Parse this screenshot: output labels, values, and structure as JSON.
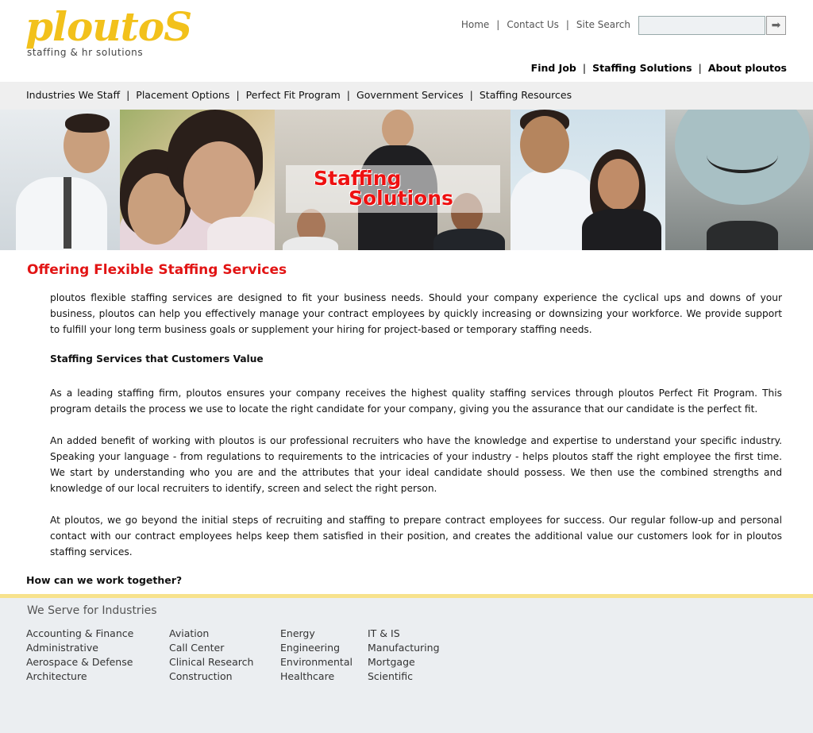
{
  "logo": {
    "word": "ploutoS",
    "tagline": "staffing & hr solutions",
    "color": "#f2c11b"
  },
  "toplinks": {
    "home": "Home",
    "contact": "Contact Us",
    "search_label": "Site Search",
    "separator": "|"
  },
  "search": {
    "value": "",
    "button_icon": "arrow-right-icon"
  },
  "mainnav": {
    "find_job": "Find Job",
    "staffing": "Staffing Solutions",
    "about": "About ploutos",
    "separator": "|"
  },
  "subnav": {
    "items": [
      "Industries We Staff",
      "Placement Options",
      "Perfect Fit Program",
      "Government Services",
      "Staffing Resources"
    ],
    "separator": "|"
  },
  "banner": {
    "line1": "Staffing",
    "line2": "Solutions",
    "title_color": "#e11111"
  },
  "content": {
    "title": "Offering Flexible Staffing Services",
    "p1": "ploutos flexible staffing services are designed to fit your business needs. Should your company experience the cyclical ups and downs of your business, ploutos can help you effectively manage your contract employees by quickly increasing or downsizing your workforce. We provide support to fulfill your long term business goals or supplement your hiring for project-based or temporary staffing needs.",
    "subhead": "Staffing Services that Customers Value",
    "p2": "As a leading staffing firm, ploutos ensures your company receives the highest quality staffing services through ploutos Perfect Fit Program. This program details the process we use to locate the right candidate for your company, giving you the assurance that our candidate is the perfect fit.",
    "p3": "An added benefit of working with ploutos is our professional recruiters who have the knowledge and expertise to understand your specific industry. Speaking your language - from regulations to requirements to the intricacies of your industry - helps ploutos staff the right employee the first time. We start by understanding who you are and the attributes that your ideal candidate should possess. We then use the combined strengths and knowledge of our local recruiters to identify, screen and select the right person.",
    "p4": "At ploutos, we go beyond the initial steps of recruiting and staffing to prepare contract employees for success. Our regular follow-up and personal contact with our contract employees helps keep them satisfied in their position, and creates the additional value our customers look for in ploutos staffing services.",
    "closing": "How can we work together?",
    "title_color": "#e21414"
  },
  "footer": {
    "title": "We Serve for Industries",
    "columns": [
      [
        "Accounting & Finance",
        "Administrative",
        "Aerospace & Defense",
        "Architecture"
      ],
      [
        "Aviation",
        "Call Center",
        "Clinical Research",
        "Construction"
      ],
      [
        "Energy",
        "Engineering",
        "Environmental",
        "Healthcare"
      ],
      [
        "IT & IS",
        "Manufacturing",
        "Mortgage",
        "Scientific"
      ]
    ],
    "accent": "#f7e28c"
  }
}
